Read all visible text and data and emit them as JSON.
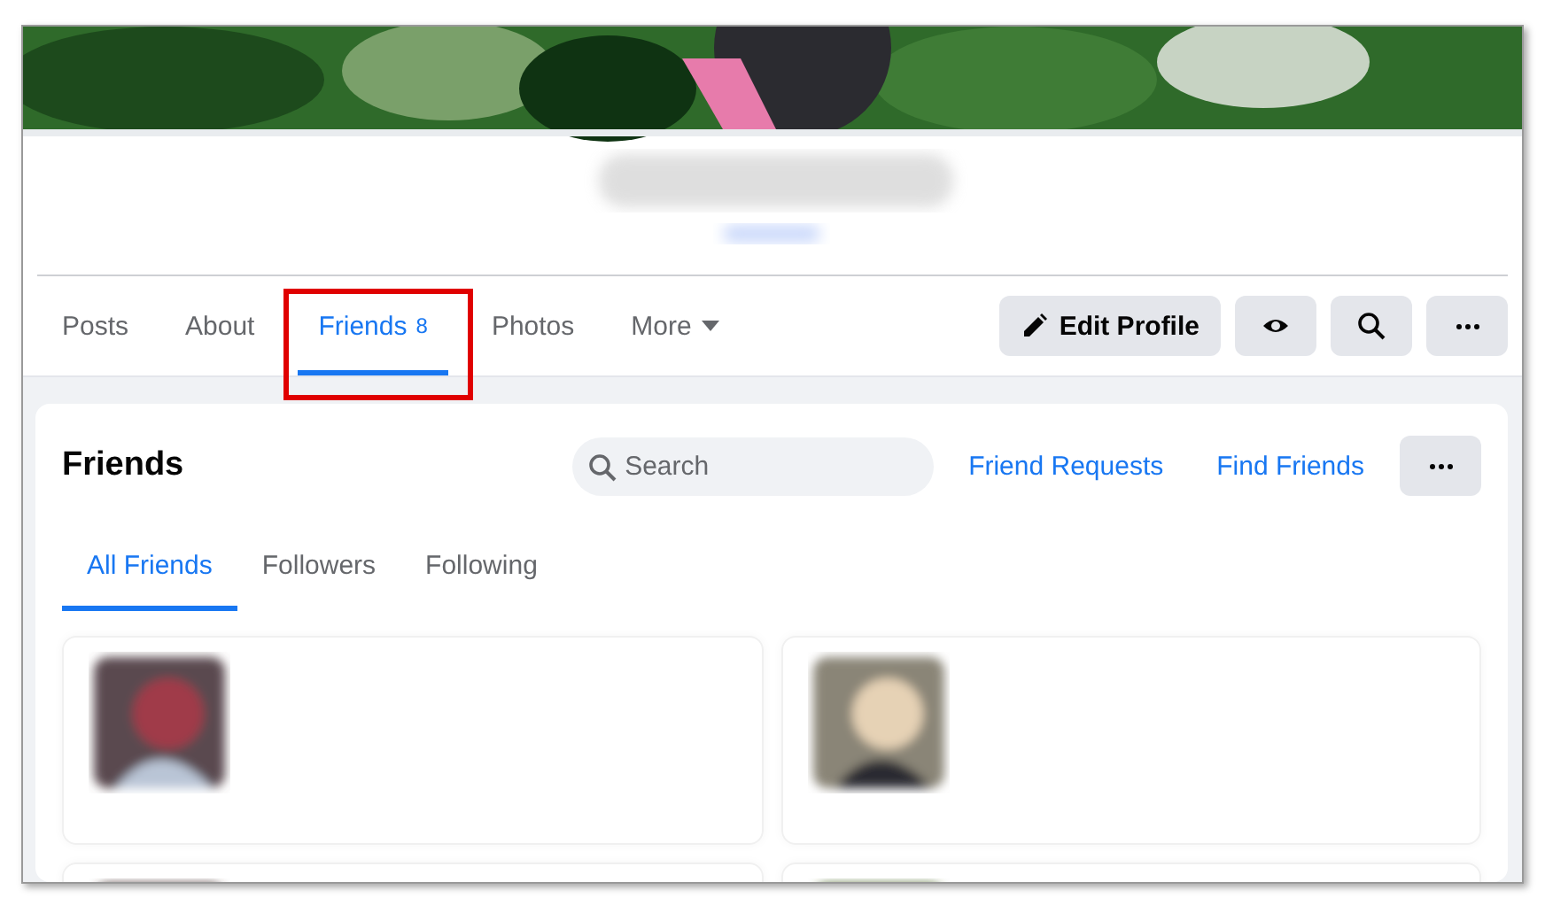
{
  "cover": {
    "kind": "picture"
  },
  "nav": {
    "tabs": [
      {
        "label": "Posts",
        "selected": false,
        "highlighted": false
      },
      {
        "label": "About",
        "selected": false,
        "highlighted": false
      },
      {
        "label": "Friends",
        "count": "8",
        "selected": true,
        "highlighted": true
      },
      {
        "label": "Photos",
        "selected": false,
        "highlighted": false
      },
      {
        "label": "More",
        "kind": "dropdown",
        "selected": false,
        "highlighted": false
      }
    ],
    "actions": [
      {
        "kind": "edit",
        "label": "Edit Profile"
      },
      {
        "kind": "view"
      },
      {
        "kind": "search"
      },
      {
        "kind": "more"
      }
    ]
  },
  "friends": {
    "title": "Friends",
    "search": {
      "placeholder": "Search"
    },
    "links": [
      "Friend Requests",
      "Find Friends"
    ],
    "subtabs": [
      {
        "label": "All Friends",
        "selected": true
      },
      {
        "label": "Followers",
        "selected": false
      },
      {
        "label": "Following",
        "selected": false
      }
    ],
    "cards": [
      {
        "kind": "picture"
      },
      {
        "kind": "picture"
      },
      {
        "kind": "picture"
      },
      {
        "kind": "picture"
      }
    ]
  }
}
